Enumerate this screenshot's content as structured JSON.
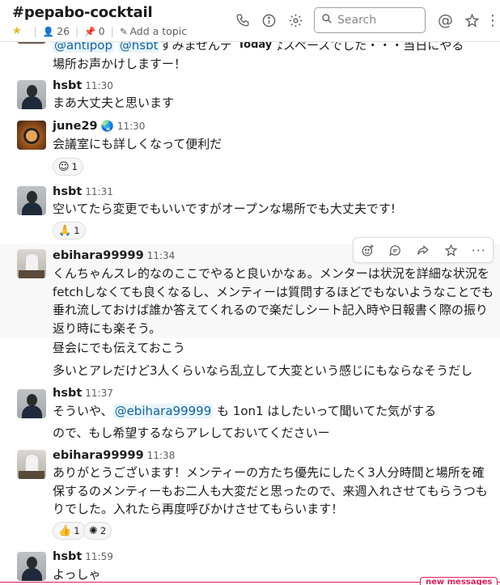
{
  "header": {
    "channel": "#pepabo-cocktail",
    "member_count": "26",
    "pinned_count": "0",
    "add_topic": "Add a topic",
    "search_placeholder": "Search"
  },
  "day_divider": "Today",
  "messages": [
    {
      "author": "",
      "time": "",
      "lines": [
        {
          "mentions": [
            "@antipop",
            "@hsbt"
          ],
          "text": "すみませんテ… penなスペースでした・・・当日にやる"
        },
        {
          "text": "場所お声かけしますー！"
        }
      ]
    },
    {
      "author": "hsbt",
      "time": "11:30",
      "text": "まあ大丈夫と思います"
    },
    {
      "author": "june29",
      "time": "11:30",
      "status_emoji": "globe-icon",
      "text": "会議室にも詳しくなって便利だ",
      "reactions": [
        {
          "emoji": "face-icon",
          "count": "1"
        }
      ]
    },
    {
      "author": "hsbt",
      "time": "11:31",
      "text": "空いてたら変更でもいいですがオープンな場所でも大丈夫です!",
      "reactions": [
        {
          "emoji": "pray-icon",
          "count": "1"
        }
      ]
    },
    {
      "author": "ebihara99999",
      "time": "11:34",
      "lines": [
        "くんちゃんスレ的なのここでやると良いかなぁ。メンターは状況を詳細な状況を",
        "fetchしなくても良くなるし、メンティーは質問するほどでもないようなことでも",
        "垂れ流しておけば誰か答えてくれるので楽だしシート記入時や日報書く際の振り",
        "返り時にも楽そう。"
      ]
    },
    {
      "continuation": true,
      "text": "昼会にでも伝えておこう"
    },
    {
      "continuation": true,
      "text": "多いとアレだけど3人くらいなら乱立して大変という感じにもならなそうだし"
    },
    {
      "author": "hsbt",
      "time": "11:37",
      "text_before": "そういや、",
      "mention": "@ebihara99999",
      "text_after": " も 1on1 はしたいって聞いてた気がする"
    },
    {
      "continuation": true,
      "text": "ので、もし希望するならアレしておいてくださいー"
    },
    {
      "author": "ebihara99999",
      "time": "11:38",
      "lines": [
        "ありがとうございます！メンティーの方たち優先にしたく3人分時間と場所を確",
        "保するのメンティーもお二人も大変だと思ったので、来週入れさせてもらうつも",
        "りでした。入れたら再度呼びかけさせてもらいます！"
      ],
      "reactions": [
        {
          "emoji": "thumbsup-icon",
          "count": "1"
        },
        {
          "emoji": "custom-emoji-icon",
          "count": "2"
        }
      ]
    },
    {
      "author": "hsbt",
      "time": "11:59",
      "text": "よっしゃ"
    }
  ],
  "new_messages_label": "new messages"
}
